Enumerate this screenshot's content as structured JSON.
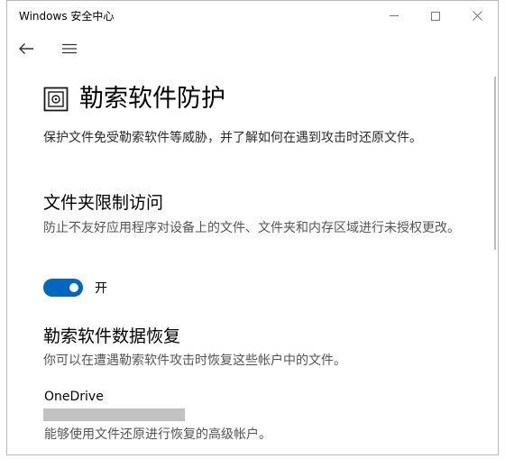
{
  "window": {
    "title": "Windows 安全中心"
  },
  "nav": {
    "back_icon": "back-arrow-icon",
    "menu_icon": "hamburger-menu-icon"
  },
  "page": {
    "icon": "ransomware-protection-icon",
    "title": "勒索软件防护",
    "description": "保护文件免受勒索软件等威胁，并了解如何在遇到攻击时还原文件。"
  },
  "folder_access": {
    "title": "文件夹限制访问",
    "description": "防止不友好应用程序对设备上的文件、文件夹和内存区域进行未授权更改。",
    "toggle_state": "on",
    "toggle_label": "开"
  },
  "data_recovery": {
    "title": "勒索软件数据恢复",
    "description": "你可以在遭遇勒索软件攻击时恢复这些帐户中的文件。",
    "account_name": "OneDrive",
    "account_note": "能够使用文件还原进行恢复的高级帐户。"
  },
  "colors": {
    "accent": "#0067c0"
  }
}
